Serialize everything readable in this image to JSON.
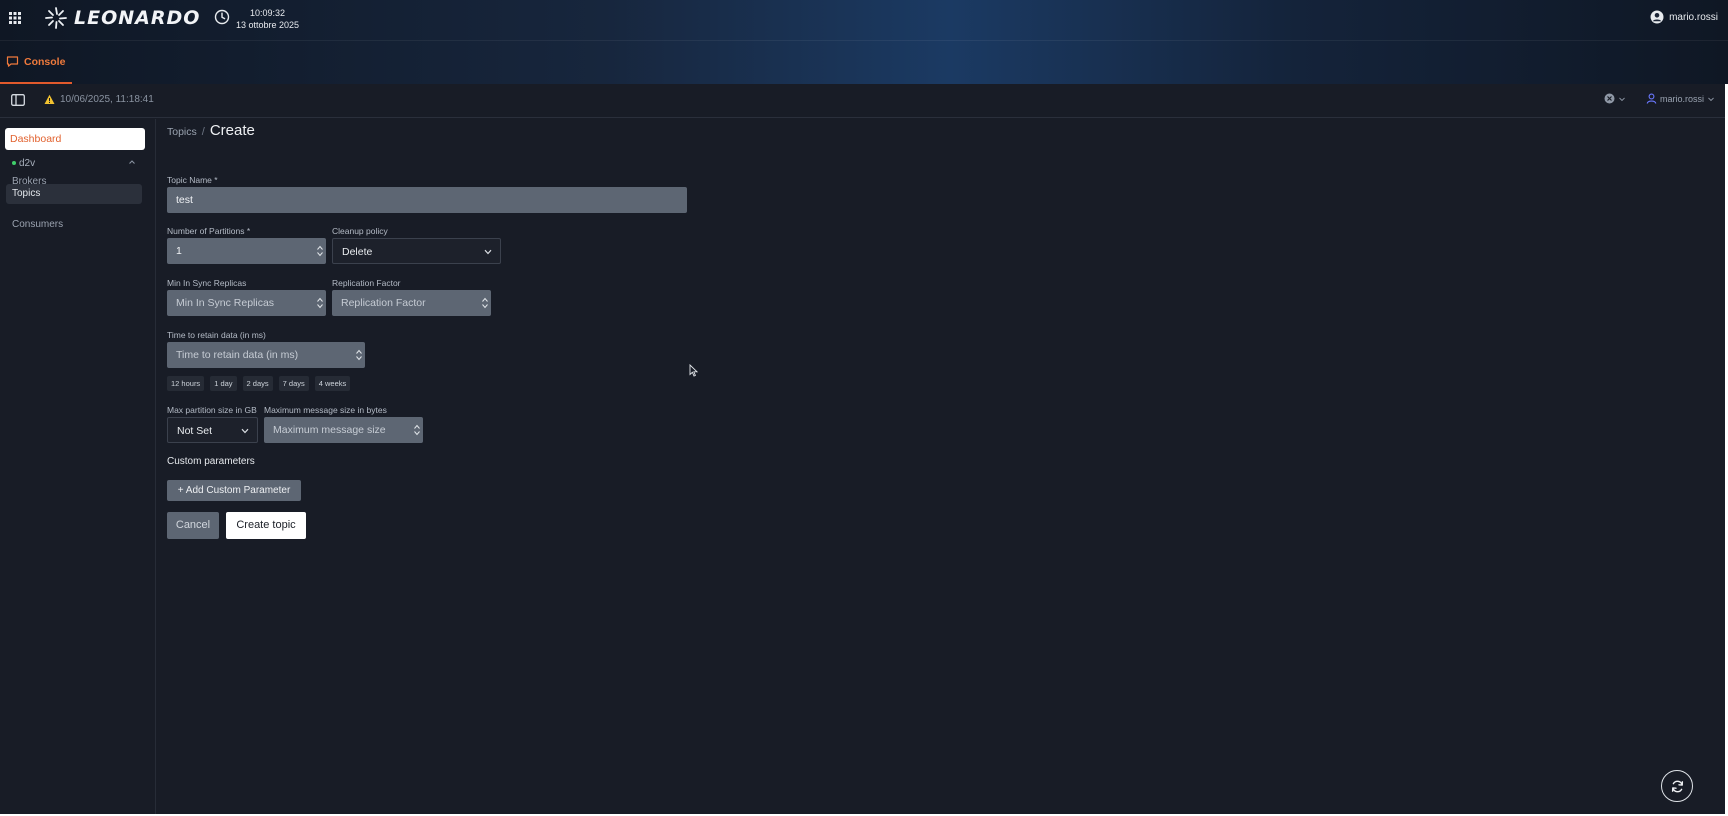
{
  "header": {
    "brand": "LEONARDO",
    "time": "10:09:32",
    "date": "13 ottobre 2025",
    "user": "mario.rossi",
    "tab_console": "Console"
  },
  "subbar": {
    "warning_timestamp": "10/06/2025, 11:18:41",
    "user": "mario.rossi"
  },
  "sidebar": {
    "dashboard": "Dashboard",
    "cluster": "d2v",
    "items": [
      "Brokers",
      "Topics",
      "Consumers"
    ]
  },
  "breadcrumb": {
    "parent": "Topics",
    "separator": "/",
    "current": "Create"
  },
  "form": {
    "topic_name_label": "Topic Name *",
    "topic_name_value": "test",
    "partitions_label": "Number of Partitions *",
    "partitions_value": "1",
    "cleanup_label": "Cleanup policy",
    "cleanup_value": "Delete",
    "min_isr_label": "Min In Sync Replicas",
    "min_isr_placeholder": "Min In Sync Replicas",
    "replication_label": "Replication Factor",
    "replication_placeholder": "Replication Factor",
    "retention_label": "Time to retain data (in ms)",
    "retention_placeholder": "Time to retain data (in ms)",
    "retention_presets": [
      "12 hours",
      "1 day",
      "2 days",
      "7 days",
      "4 weeks"
    ],
    "max_partition_label": "Max partition size in GB",
    "max_partition_value": "Not Set",
    "max_message_label": "Maximum message size in bytes",
    "max_message_placeholder": "Maximum message size",
    "custom_params_title": "Custom parameters",
    "add_custom_param": "+ Add Custom Parameter",
    "cancel": "Cancel",
    "create": "Create topic"
  },
  "icons": {
    "apps": "apps-grid-icon",
    "clock": "clock-icon",
    "user": "user-circle-icon",
    "console": "chat-bubble-icon",
    "panel": "panel-toggle-icon",
    "warning": "warning-triangle-icon",
    "refresh": "refresh-icon"
  },
  "colors": {
    "accent": "#e2622f",
    "bg": "#181c26",
    "input": "#5d6673",
    "online": "#3fce6a"
  }
}
